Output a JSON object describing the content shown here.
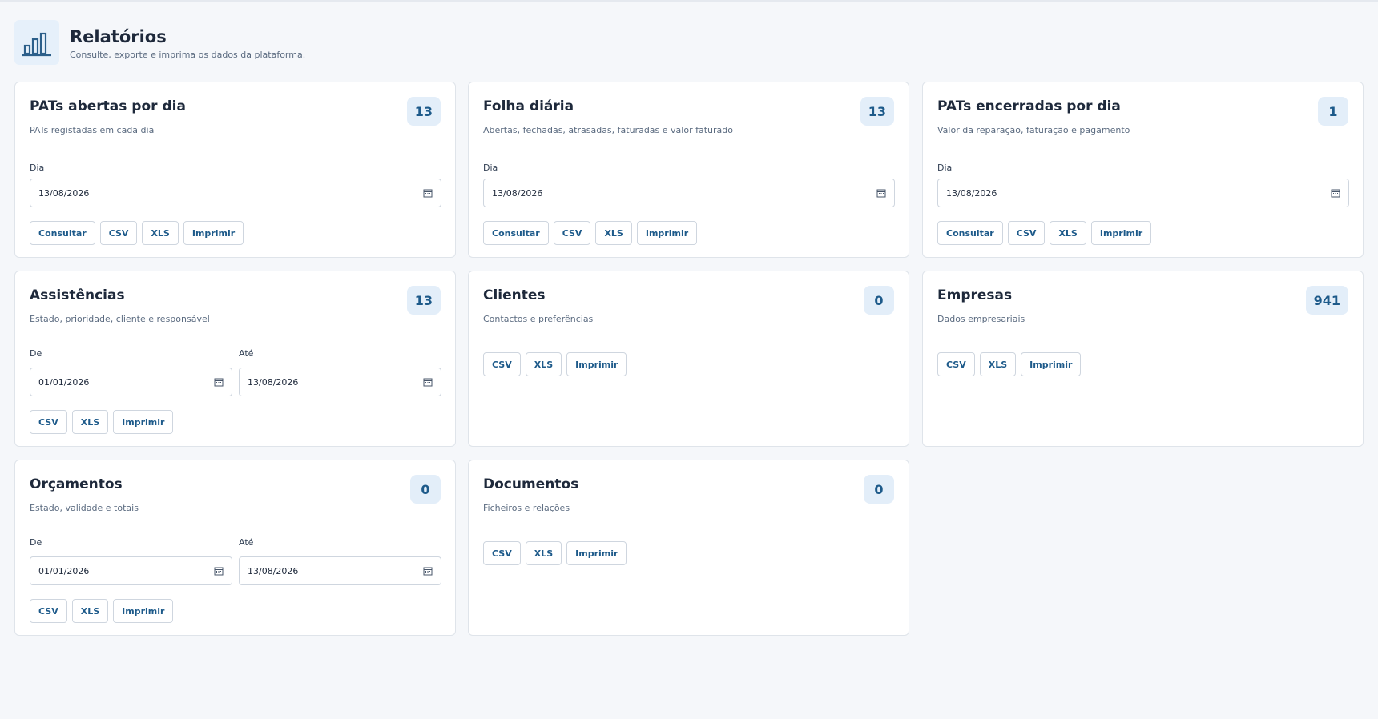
{
  "page": {
    "title": "Relatórios",
    "subtitle": "Consulte, exporte e imprima os dados da plataforma.",
    "icon": "bar-chart-icon"
  },
  "labels": {
    "consultar": "Consultar",
    "csv": "CSV",
    "xls": "XLS",
    "imprimir": "Imprimir",
    "dia": "Dia",
    "de": "De",
    "ate": "Até"
  },
  "cards": {
    "pats_abertas": {
      "title": "PATs abertas por dia",
      "description": "PATs registadas em cada dia",
      "count": "13",
      "date": "13/08/2026"
    },
    "folha_diaria": {
      "title": "Folha diária",
      "description": "Abertas, fechadas, atrasadas, faturadas e valor faturado",
      "count": "13",
      "date": "13/08/2026"
    },
    "pats_encerradas": {
      "title": "PATs encerradas por dia",
      "description": "Valor da reparação, faturação e pagamento",
      "count": "1",
      "date": "13/08/2026"
    },
    "assistencias": {
      "title": "Assistências",
      "description": "Estado, prioridade, cliente e responsável",
      "count": "13",
      "date_from": "01/01/2026",
      "date_to": "13/08/2026"
    },
    "clientes": {
      "title": "Clientes",
      "description": "Contactos e preferências",
      "count": "0"
    },
    "empresas": {
      "title": "Empresas",
      "description": "Dados empresariais",
      "count": "941"
    },
    "orcamentos": {
      "title": "Orçamentos",
      "description": "Estado, validade e totais",
      "count": "0",
      "date_from": "01/01/2026",
      "date_to": "13/08/2026"
    },
    "documentos": {
      "title": "Documentos",
      "description": "Ficheiros e relações",
      "count": "0"
    }
  },
  "colors": {
    "accent": "#1d5a8a",
    "badge_bg": "#e3eef9",
    "background": "#f5f7fa"
  }
}
